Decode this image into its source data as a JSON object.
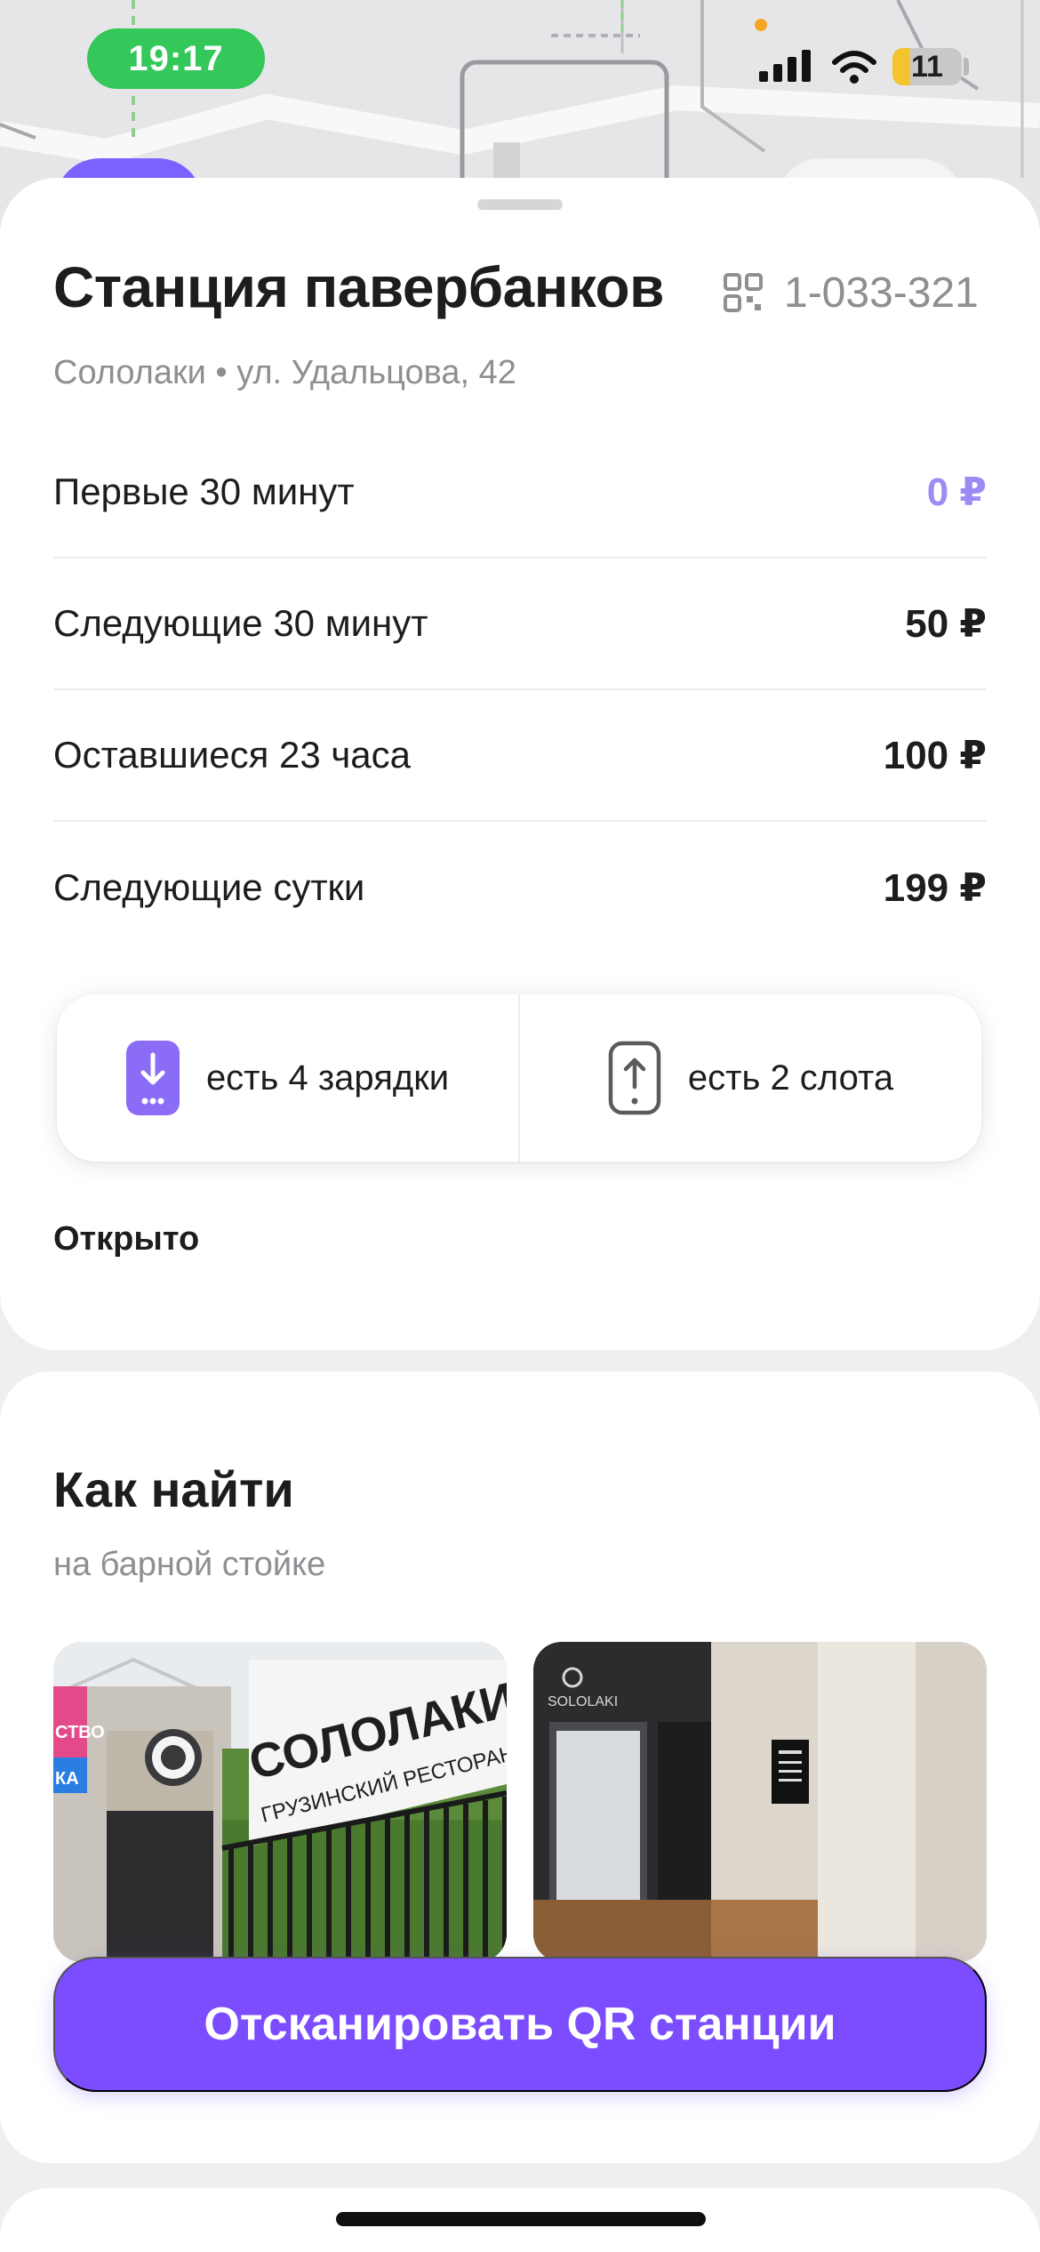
{
  "status_bar": {
    "time": "19:17",
    "battery": "11",
    "battery_level_percent": 11
  },
  "station": {
    "title": "Станция павербанков",
    "code": "1-033-321",
    "address": "Сололаки • ул. Удальцова, 42"
  },
  "tariffs": [
    {
      "label": "Первые 30 минут",
      "price": "0 ₽"
    },
    {
      "label": "Следующие 30 минут",
      "price": "50 ₽"
    },
    {
      "label": "Оставшиеся 23 часа",
      "price": "100 ₽"
    },
    {
      "label": "Следующие сутки",
      "price": "199 ₽"
    }
  ],
  "availability": {
    "chargers": "есть 4 зарядки",
    "slots": "есть 2 слота"
  },
  "open_status": "Открыто",
  "how_to_find": {
    "title": "Как найти",
    "hint": "на барной стойке"
  },
  "photos": {
    "sign_1_line_1": "СОЛОЛАКИ",
    "sign_1_line_2": "ГРУЗИНСКИЙ РЕСТОРАН",
    "sign_1_side_a": "СТВО",
    "sign_1_side_b": "КА",
    "sign_2_logo": "SOLOLAKI"
  },
  "actions": {
    "scan_qr": "Отсканировать QR станции"
  },
  "icons": {
    "qr": "qr-code-icon",
    "download": "powerbank-download-icon",
    "upload": "slot-upload-icon",
    "signal": "cellular-signal-icon",
    "wifi": "wifi-icon"
  },
  "colors": {
    "accent": "#7b4dff",
    "free_price": "#9b8cf5",
    "time_pill": "#34c759",
    "muted_text": "#8e8e93"
  }
}
